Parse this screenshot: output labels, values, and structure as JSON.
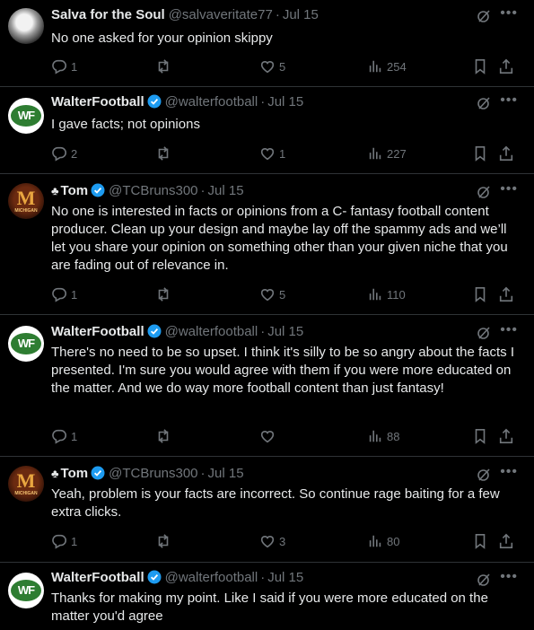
{
  "tweets": [
    {
      "name": "Salva for the Soul",
      "prefix": "",
      "handle": "@salvaveritate77",
      "date": "Jul 15",
      "verified": false,
      "text": "No one asked for your opinion skippy",
      "replies": "1",
      "reposts": "",
      "likes": "5",
      "views": "254"
    },
    {
      "name": "WalterFootball",
      "prefix": "",
      "handle": "@walterfootball",
      "date": "Jul 15",
      "verified": true,
      "text": "I gave facts; not opinions",
      "replies": "2",
      "reposts": "",
      "likes": "1",
      "views": "227"
    },
    {
      "name": "Tom",
      "prefix": "♣",
      "handle": "@TCBruns300",
      "date": "Jul 15",
      "verified": true,
      "text": "No one is interested in facts or opinions from a C- fantasy football content producer. Clean up your design and maybe lay off the spammy ads and we’ll let you share your opinion on something other than your given niche that you are fading out of relevance in.",
      "replies": "1",
      "reposts": "",
      "likes": "5",
      "views": "110"
    },
    {
      "name": "WalterFootball",
      "prefix": "",
      "handle": "@walterfootball",
      "date": "Jul 15",
      "verified": true,
      "text": "There's no need to be so upset. I think it's silly to be so angry about the facts I presented. I'm sure you would agree with them if you were more educated on the matter. And we do way more football content than just fantasy!",
      "replies": "1",
      "reposts": "",
      "likes": "",
      "views": "88"
    },
    {
      "name": "Tom",
      "prefix": "♣",
      "handle": "@TCBruns300",
      "date": "Jul 15",
      "verified": true,
      "text": "Yeah, problem is your facts are incorrect. So continue rage baiting for a few extra clicks.",
      "replies": "1",
      "reposts": "",
      "likes": "3",
      "views": "80"
    },
    {
      "name": "WalterFootball",
      "prefix": "",
      "handle": "@walterfootball",
      "date": "Jul 15",
      "verified": true,
      "text": "Thanks for making my point. Like I said if you were more educated on the matter you'd agree",
      "replies": "",
      "reposts": "",
      "likes": "",
      "views": ""
    }
  ],
  "avatars": {
    "wf_text": "WF",
    "tom_letter": "M",
    "tom_sub": "MICHIGAN"
  },
  "colors": {
    "accent": "#1d9bf0",
    "muted": "#71767b",
    "text": "#e7e9ea",
    "background": "#000000"
  }
}
